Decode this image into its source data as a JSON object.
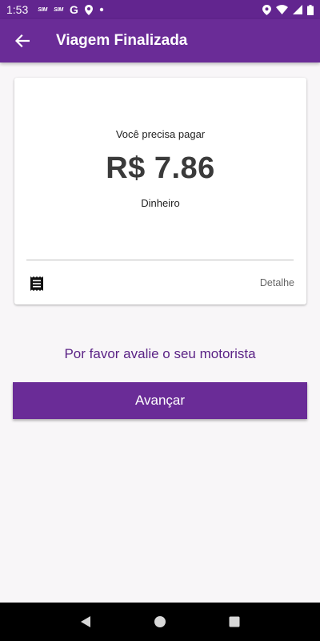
{
  "status_bar": {
    "time": "1:53",
    "badges": [
      "SIM",
      "SIM"
    ],
    "google_glyph": "G",
    "icons": [
      "location-pin-icon",
      "dot-icon",
      "location-icon",
      "wifi-icon",
      "signal-icon",
      "battery-icon"
    ]
  },
  "app_bar": {
    "back_icon": "arrow-left-icon",
    "title": "Viagem Finalizada"
  },
  "payment_card": {
    "prompt": "Você precisa pagar",
    "amount": "R$ 7.86",
    "method": "Dinheiro",
    "receipt_icon": "receipt-icon",
    "detail_label": "Detalhe"
  },
  "rating": {
    "prompt": "Por favor avalie o seu motorista"
  },
  "primary_action": {
    "label": "Avançar"
  },
  "nav_bar": {
    "icons": [
      "back-triangle-icon",
      "home-circle-icon",
      "recents-square-icon"
    ]
  },
  "colors": {
    "primary": "#6a2c97",
    "status_bar": "#62258f",
    "accent_text": "#5b2386",
    "background": "#f8f6f8"
  }
}
